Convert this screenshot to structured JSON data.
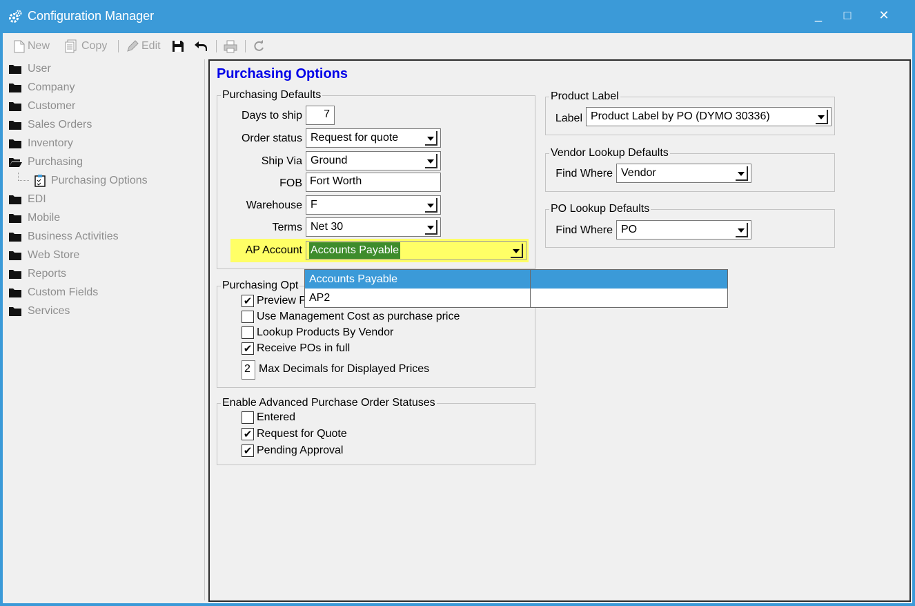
{
  "window": {
    "title": "Configuration Manager",
    "controls": {
      "minimize": "_",
      "maximize": "□",
      "close": "✕"
    }
  },
  "toolbar": {
    "new_label": "New",
    "copy_label": "Copy",
    "edit_label": "Edit"
  },
  "tree": {
    "items": [
      {
        "label": "User",
        "icon": "folder-icon"
      },
      {
        "label": "Company",
        "icon": "folder-icon"
      },
      {
        "label": "Customer",
        "icon": "folder-icon"
      },
      {
        "label": "Sales Orders",
        "icon": "folder-icon"
      },
      {
        "label": "Inventory",
        "icon": "folder-icon"
      },
      {
        "label": "Purchasing",
        "icon": "folder-open-icon"
      },
      {
        "label": "Purchasing Options",
        "icon": "checklist-icon"
      },
      {
        "label": "EDI",
        "icon": "folder-icon"
      },
      {
        "label": "Mobile",
        "icon": "folder-icon"
      },
      {
        "label": "Business Activities",
        "icon": "folder-icon"
      },
      {
        "label": "Web Store",
        "icon": "folder-icon"
      },
      {
        "label": "Reports",
        "icon": "folder-icon"
      },
      {
        "label": "Custom Fields",
        "icon": "folder-icon"
      },
      {
        "label": "Services",
        "icon": "folder-icon"
      }
    ]
  },
  "panel": {
    "title": "Purchasing Options",
    "defaults": {
      "legend": "Purchasing Defaults",
      "days_to_ship_label": "Days to ship",
      "days_to_ship": "7",
      "order_status_label": "Order status",
      "order_status": "Request for quote",
      "ship_via_label": "Ship Via",
      "ship_via": "Ground",
      "fob_label": "FOB",
      "fob": "Fort Worth",
      "warehouse_label": "Warehouse",
      "warehouse": "F",
      "terms_label": "Terms",
      "terms": "Net 30",
      "ap_account_label": "AP Account",
      "ap_account": "Accounts Payable"
    },
    "options": {
      "legend": "Purchasing Opt",
      "preview_po_print": "Preview PO Print",
      "use_mgmt_cost": "Use Management Cost as purchase price",
      "lookup_by_vendor": "Lookup Products By Vendor",
      "receive_in_full": "Receive POs in full",
      "max_decimals_value": "2",
      "max_decimals_label": "Max Decimals for Displayed Prices"
    },
    "statuses": {
      "legend": "Enable Advanced Purchase Order Statuses",
      "entered": "Entered",
      "request_for_quote": "Request for Quote",
      "pending_approval": "Pending Approval"
    },
    "product_label": {
      "legend": "Product Label",
      "label_label": "Label",
      "label_value": "Product Label by PO (DYMO 30336)"
    },
    "vendor_lookup": {
      "legend": "Vendor Lookup Defaults",
      "find_where_label": "Find Where",
      "find_where": "Vendor"
    },
    "po_lookup": {
      "legend": "PO Lookup Defaults",
      "find_where_label": "Find Where",
      "find_where": "PO"
    }
  },
  "dropdown": {
    "options": [
      "Accounts Payable",
      "AP2"
    ]
  },
  "colors": {
    "titlebar": "#3b9ad8",
    "highlight": "#ffff66",
    "selected_value_bg": "#3e8c2c",
    "dropdown_selected": "#3b9ad8",
    "panel_title": "#0000e8"
  }
}
